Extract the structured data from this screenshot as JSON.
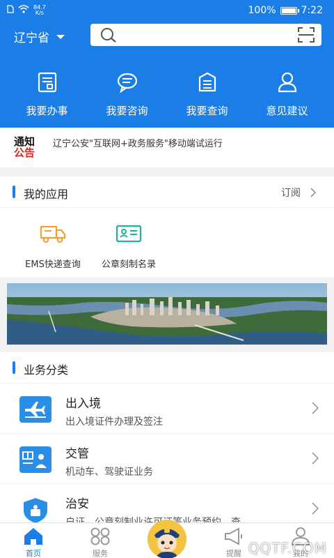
{
  "status_bar": {
    "network_speed_value": "84.7",
    "network_speed_unit": "K/s",
    "battery_text": "100%",
    "battery_level": 1.0,
    "time": "7:22"
  },
  "header": {
    "province": "辽宁省"
  },
  "quick_actions": [
    {
      "label": "我要办事",
      "icon": "form-icon"
    },
    {
      "label": "我要咨询",
      "icon": "chat-bubble-icon"
    },
    {
      "label": "我要查询",
      "icon": "document-list-icon"
    },
    {
      "label": "意见建议",
      "icon": "user-icon"
    }
  ],
  "notice": {
    "badge_line1": "通知",
    "badge_line2": "公告",
    "text": "辽宁公安\"互联网+政务服务\"移动端试运行"
  },
  "my_apps": {
    "title": "我的应用",
    "more_label": "订阅",
    "items": [
      {
        "label": "EMS快递查询",
        "icon": "delivery-truck-icon"
      },
      {
        "label": "公章刻制名录",
        "icon": "id-card-icon"
      }
    ]
  },
  "business": {
    "title": "业务分类",
    "items": [
      {
        "title": "出入境",
        "subtitle": "出入境证件办理及签注",
        "icon": "airplane-icon"
      },
      {
        "title": "交管",
        "subtitle": "机动车、驾驶证业务",
        "icon": "driver-license-icon"
      },
      {
        "title": "治安",
        "subtitle": "户证、公章刻制业许可证等业务预约、查",
        "icon": "police-badge-icon"
      }
    ]
  },
  "tabbar": {
    "tabs": [
      {
        "label": "首页",
        "icon": "home-icon",
        "active": true
      },
      {
        "label": "服务",
        "icon": "grid-icon",
        "active": false
      },
      {
        "label": "提醒",
        "icon": "megaphone-icon",
        "active": false
      },
      {
        "label": "我的",
        "icon": "profile-icon",
        "active": false
      }
    ]
  },
  "watermark": "QQTF.COM",
  "colors": {
    "primary": "#1a7ee6",
    "notice_red": "#d9261c",
    "app_orange": "#f0a030",
    "app_teal": "#1bb39a"
  }
}
